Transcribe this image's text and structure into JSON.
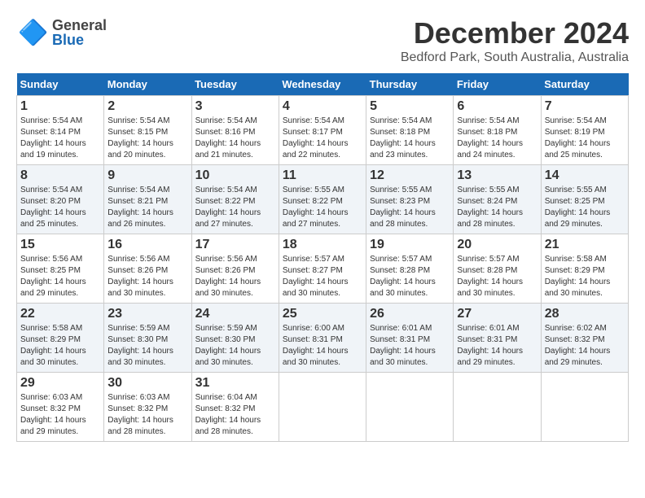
{
  "header": {
    "logo_general": "General",
    "logo_blue": "Blue",
    "month_title": "December 2024",
    "location": "Bedford Park, South Australia, Australia"
  },
  "weekdays": [
    "Sunday",
    "Monday",
    "Tuesday",
    "Wednesday",
    "Thursday",
    "Friday",
    "Saturday"
  ],
  "weeks": [
    [
      {
        "day": "1",
        "info": "Sunrise: 5:54 AM\nSunset: 8:14 PM\nDaylight: 14 hours\nand 19 minutes."
      },
      {
        "day": "2",
        "info": "Sunrise: 5:54 AM\nSunset: 8:15 PM\nDaylight: 14 hours\nand 20 minutes."
      },
      {
        "day": "3",
        "info": "Sunrise: 5:54 AM\nSunset: 8:16 PM\nDaylight: 14 hours\nand 21 minutes."
      },
      {
        "day": "4",
        "info": "Sunrise: 5:54 AM\nSunset: 8:17 PM\nDaylight: 14 hours\nand 22 minutes."
      },
      {
        "day": "5",
        "info": "Sunrise: 5:54 AM\nSunset: 8:18 PM\nDaylight: 14 hours\nand 23 minutes."
      },
      {
        "day": "6",
        "info": "Sunrise: 5:54 AM\nSunset: 8:18 PM\nDaylight: 14 hours\nand 24 minutes."
      },
      {
        "day": "7",
        "info": "Sunrise: 5:54 AM\nSunset: 8:19 PM\nDaylight: 14 hours\nand 25 minutes."
      }
    ],
    [
      {
        "day": "8",
        "info": "Sunrise: 5:54 AM\nSunset: 8:20 PM\nDaylight: 14 hours\nand 25 minutes."
      },
      {
        "day": "9",
        "info": "Sunrise: 5:54 AM\nSunset: 8:21 PM\nDaylight: 14 hours\nand 26 minutes."
      },
      {
        "day": "10",
        "info": "Sunrise: 5:54 AM\nSunset: 8:22 PM\nDaylight: 14 hours\nand 27 minutes."
      },
      {
        "day": "11",
        "info": "Sunrise: 5:55 AM\nSunset: 8:22 PM\nDaylight: 14 hours\nand 27 minutes."
      },
      {
        "day": "12",
        "info": "Sunrise: 5:55 AM\nSunset: 8:23 PM\nDaylight: 14 hours\nand 28 minutes."
      },
      {
        "day": "13",
        "info": "Sunrise: 5:55 AM\nSunset: 8:24 PM\nDaylight: 14 hours\nand 28 minutes."
      },
      {
        "day": "14",
        "info": "Sunrise: 5:55 AM\nSunset: 8:25 PM\nDaylight: 14 hours\nand 29 minutes."
      }
    ],
    [
      {
        "day": "15",
        "info": "Sunrise: 5:56 AM\nSunset: 8:25 PM\nDaylight: 14 hours\nand 29 minutes."
      },
      {
        "day": "16",
        "info": "Sunrise: 5:56 AM\nSunset: 8:26 PM\nDaylight: 14 hours\nand 30 minutes."
      },
      {
        "day": "17",
        "info": "Sunrise: 5:56 AM\nSunset: 8:26 PM\nDaylight: 14 hours\nand 30 minutes."
      },
      {
        "day": "18",
        "info": "Sunrise: 5:57 AM\nSunset: 8:27 PM\nDaylight: 14 hours\nand 30 minutes."
      },
      {
        "day": "19",
        "info": "Sunrise: 5:57 AM\nSunset: 8:28 PM\nDaylight: 14 hours\nand 30 minutes."
      },
      {
        "day": "20",
        "info": "Sunrise: 5:57 AM\nSunset: 8:28 PM\nDaylight: 14 hours\nand 30 minutes."
      },
      {
        "day": "21",
        "info": "Sunrise: 5:58 AM\nSunset: 8:29 PM\nDaylight: 14 hours\nand 30 minutes."
      }
    ],
    [
      {
        "day": "22",
        "info": "Sunrise: 5:58 AM\nSunset: 8:29 PM\nDaylight: 14 hours\nand 30 minutes."
      },
      {
        "day": "23",
        "info": "Sunrise: 5:59 AM\nSunset: 8:30 PM\nDaylight: 14 hours\nand 30 minutes."
      },
      {
        "day": "24",
        "info": "Sunrise: 5:59 AM\nSunset: 8:30 PM\nDaylight: 14 hours\nand 30 minutes."
      },
      {
        "day": "25",
        "info": "Sunrise: 6:00 AM\nSunset: 8:31 PM\nDaylight: 14 hours\nand 30 minutes."
      },
      {
        "day": "26",
        "info": "Sunrise: 6:01 AM\nSunset: 8:31 PM\nDaylight: 14 hours\nand 30 minutes."
      },
      {
        "day": "27",
        "info": "Sunrise: 6:01 AM\nSunset: 8:31 PM\nDaylight: 14 hours\nand 29 minutes."
      },
      {
        "day": "28",
        "info": "Sunrise: 6:02 AM\nSunset: 8:32 PM\nDaylight: 14 hours\nand 29 minutes."
      }
    ],
    [
      {
        "day": "29",
        "info": "Sunrise: 6:03 AM\nSunset: 8:32 PM\nDaylight: 14 hours\nand 29 minutes."
      },
      {
        "day": "30",
        "info": "Sunrise: 6:03 AM\nSunset: 8:32 PM\nDaylight: 14 hours\nand 28 minutes."
      },
      {
        "day": "31",
        "info": "Sunrise: 6:04 AM\nSunset: 8:32 PM\nDaylight: 14 hours\nand 28 minutes."
      },
      null,
      null,
      null,
      null
    ]
  ]
}
